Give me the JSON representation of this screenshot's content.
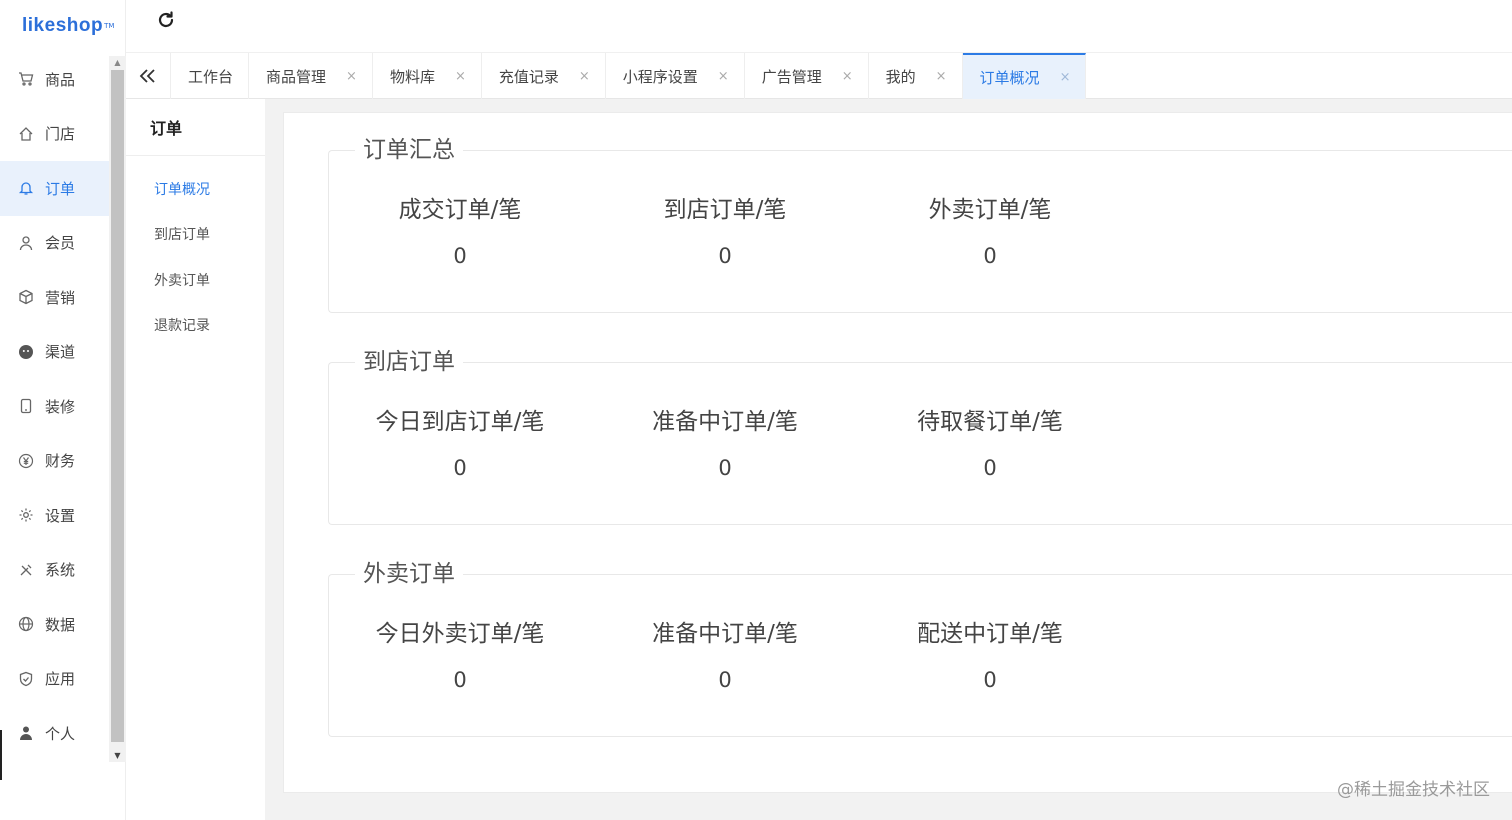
{
  "logo": {
    "text": "likeshop",
    "tm": "TM"
  },
  "sidebar": {
    "items": [
      {
        "label": "商品",
        "icon": "cart-icon"
      },
      {
        "label": "门店",
        "icon": "home-icon"
      },
      {
        "label": "订单",
        "icon": "bell-icon",
        "active": true
      },
      {
        "label": "会员",
        "icon": "user-icon"
      },
      {
        "label": "营销",
        "icon": "box-icon"
      },
      {
        "label": "渠道",
        "icon": "wechat-icon"
      },
      {
        "label": "装修",
        "icon": "phone-icon"
      },
      {
        "label": "财务",
        "icon": "yen-icon"
      },
      {
        "label": "设置",
        "icon": "gear-icon"
      },
      {
        "label": "系统",
        "icon": "tools-icon"
      },
      {
        "label": "数据",
        "icon": "globe-icon"
      },
      {
        "label": "应用",
        "icon": "shield-icon"
      },
      {
        "label": "个人",
        "icon": "person-icon"
      }
    ]
  },
  "tabs": [
    {
      "label": "工作台",
      "closable": false
    },
    {
      "label": "商品管理",
      "closable": true
    },
    {
      "label": "物料库",
      "closable": true
    },
    {
      "label": "充值记录",
      "closable": true
    },
    {
      "label": "小程序设置",
      "closable": true
    },
    {
      "label": "广告管理",
      "closable": true
    },
    {
      "label": "我的",
      "closable": true
    },
    {
      "label": "订单概况",
      "closable": true,
      "active": true
    }
  ],
  "close_glyph": "×",
  "submenu": {
    "title": "订单",
    "items": [
      {
        "label": "订单概况",
        "active": true
      },
      {
        "label": "到店订单"
      },
      {
        "label": "外卖订单"
      },
      {
        "label": "退款记录"
      }
    ]
  },
  "groups": [
    {
      "title": "订单汇总",
      "stats": [
        {
          "label": "成交订单/笔",
          "value": "0"
        },
        {
          "label": "到店订单/笔",
          "value": "0"
        },
        {
          "label": "外卖订单/笔",
          "value": "0"
        }
      ]
    },
    {
      "title": "到店订单",
      "stats": [
        {
          "label": "今日到店订单/笔",
          "value": "0"
        },
        {
          "label": "准备中订单/笔",
          "value": "0"
        },
        {
          "label": "待取餐订单/笔",
          "value": "0"
        }
      ]
    },
    {
      "title": "外卖订单",
      "stats": [
        {
          "label": "今日外卖订单/笔",
          "value": "0"
        },
        {
          "label": "准备中订单/笔",
          "value": "0"
        },
        {
          "label": "配送中订单/笔",
          "value": "0"
        }
      ]
    }
  ],
  "watermark": "@稀土掘金技术社区",
  "colors": {
    "accent": "#2c7be5",
    "active_bg": "#e8f1fc"
  }
}
